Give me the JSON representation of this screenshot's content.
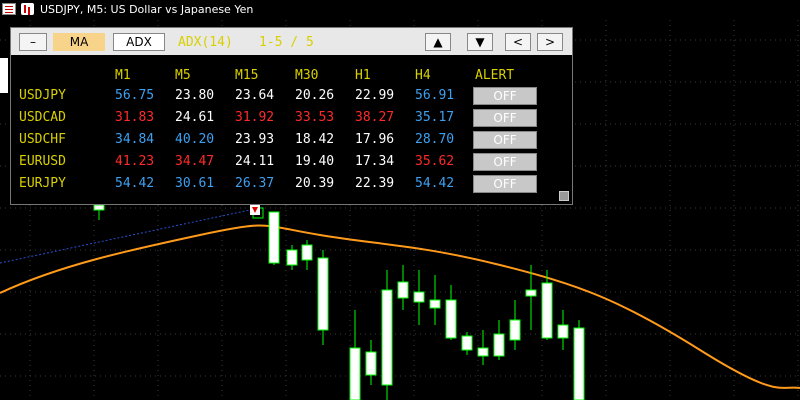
{
  "window": {
    "title": "USDJPY, M5:  US Dollar vs Japanese Yen"
  },
  "toolbar": {
    "minimize_label": "–",
    "ma_label": "MA",
    "adx_label": "ADX",
    "indicator_label": "ADX(14)",
    "page_label": "1-5 / 5",
    "up_label": "▲",
    "down_label": "▼",
    "prev_label": "<",
    "next_label": ">"
  },
  "table": {
    "headers": [
      "M1",
      "M5",
      "M15",
      "M30",
      "H1",
      "H4",
      "ALERT"
    ],
    "rows": [
      {
        "symbol": "USDJPY",
        "values": [
          "56.75",
          "23.80",
          "23.64",
          "20.26",
          "22.99",
          "56.91"
        ],
        "colors": [
          "blue",
          "white",
          "white",
          "white",
          "white",
          "blue"
        ],
        "alert": "OFF"
      },
      {
        "symbol": "USDCAD",
        "values": [
          "31.83",
          "24.61",
          "31.92",
          "33.53",
          "38.27",
          "35.17"
        ],
        "colors": [
          "red",
          "white",
          "red",
          "red",
          "red",
          "blue"
        ],
        "alert": "OFF"
      },
      {
        "symbol": "USDCHF",
        "values": [
          "34.84",
          "40.20",
          "23.93",
          "18.42",
          "17.96",
          "28.70"
        ],
        "colors": [
          "blue",
          "blue",
          "white",
          "white",
          "white",
          "blue"
        ],
        "alert": "OFF"
      },
      {
        "symbol": "EURUSD",
        "values": [
          "41.23",
          "34.47",
          "24.11",
          "19.40",
          "17.34",
          "35.62"
        ],
        "colors": [
          "red",
          "red",
          "white",
          "white",
          "white",
          "red"
        ],
        "alert": "OFF"
      },
      {
        "symbol": "EURJPY",
        "values": [
          "54.42",
          "30.61",
          "26.37",
          "20.39",
          "22.39",
          "54.42"
        ],
        "colors": [
          "blue",
          "blue",
          "blue",
          "white",
          "white",
          "blue"
        ],
        "alert": "OFF"
      }
    ]
  },
  "colors": {
    "blue": "#3ea0f0",
    "red": "#ff2a2a",
    "white": "#ffffff",
    "yellow": "#d8d000",
    "ma_line": "#ff9a1a",
    "bull": "#ffffff",
    "bear": "#ffffff",
    "wick": "#00ff00"
  }
}
